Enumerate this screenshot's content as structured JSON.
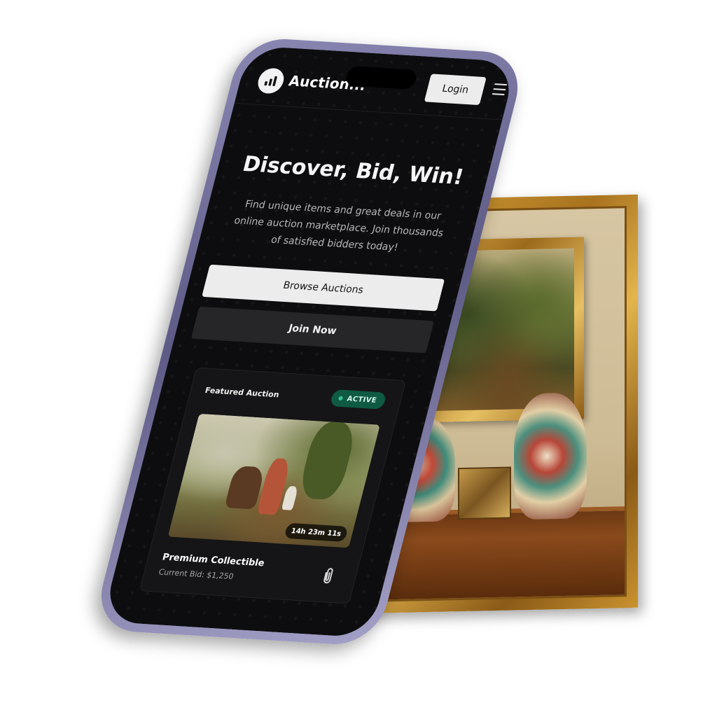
{
  "app": {
    "brand": "Auction...",
    "login_label": "Login"
  },
  "hero": {
    "title": "Discover, Bid, Win!",
    "subtitle": "Find unique items and great deals in our online auction marketplace. Join thousands of satisfied bidders today!",
    "browse_label": "Browse Auctions",
    "join_label": "Join Now"
  },
  "featured": {
    "label": "Featured Auction",
    "status": "ACTIVE",
    "timer": "14h 23m 11s",
    "item_title": "Premium Collectible",
    "current_bid": "Current Bid: $1,250"
  },
  "icons": {
    "logo": "chart-bars-icon",
    "menu": "hamburger-menu-icon",
    "attachment": "paperclip-icon"
  },
  "colors": {
    "screen_bg": "#0d0d0f",
    "badge_bg": "#0f5a43",
    "badge_dot": "#39c28a",
    "phone_frame": "#6d6a98"
  }
}
